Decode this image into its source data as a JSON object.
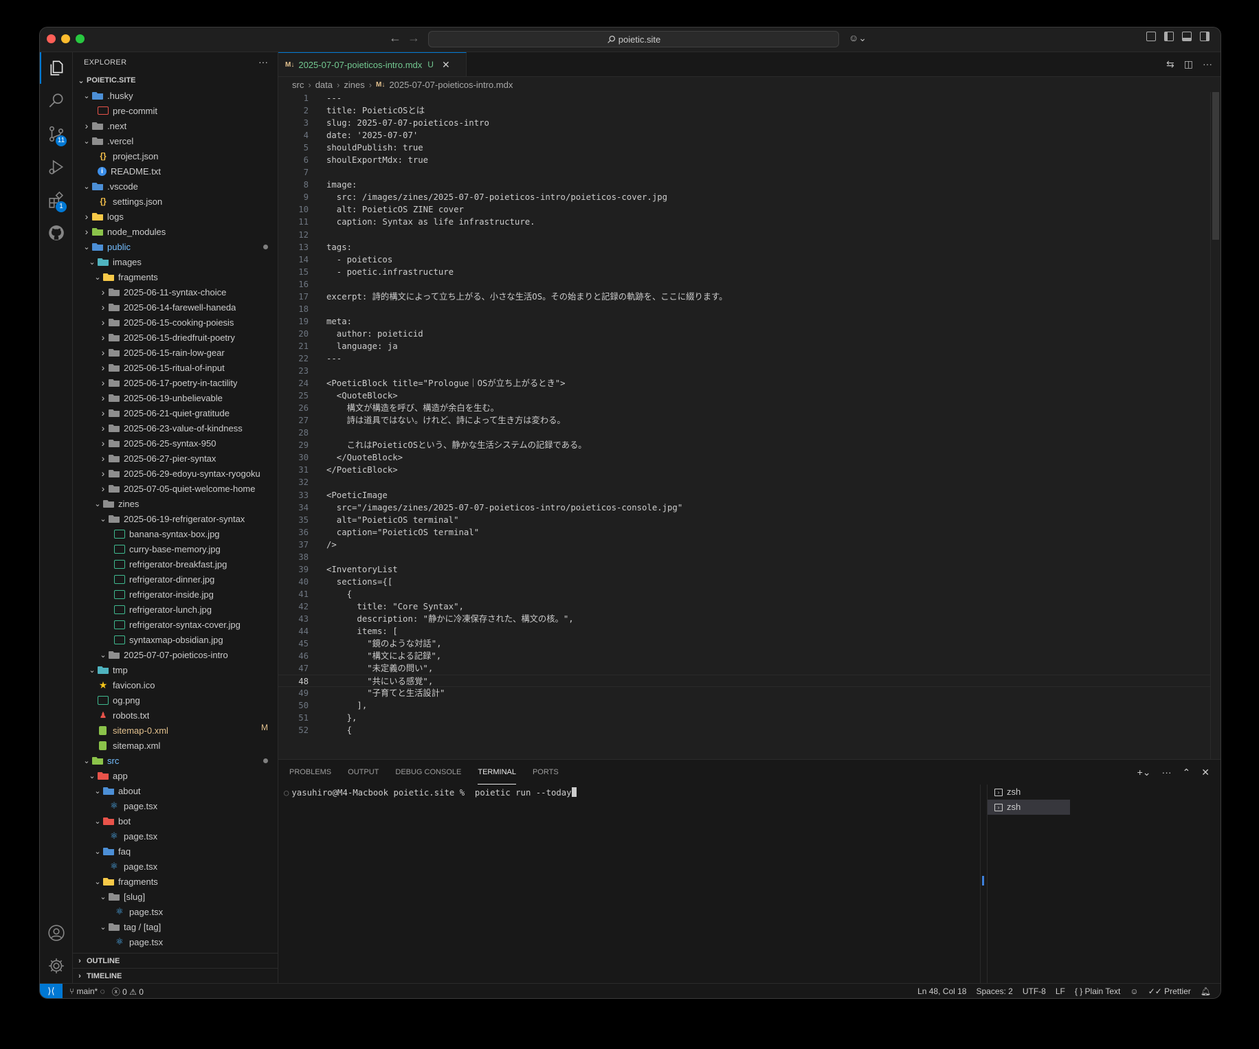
{
  "window": {
    "address": "poietic.site"
  },
  "activity": {
    "scm_badge": "11",
    "extensions_badge": "1"
  },
  "explorer": {
    "title": "EXPLORER",
    "root": "POIETIC.SITE",
    "items": [
      {
        "label": ".husky",
        "depth": 1,
        "kind": "folder",
        "open": true,
        "color": "blue"
      },
      {
        "label": "pre-commit",
        "depth": 2,
        "kind": "term"
      },
      {
        "label": ".next",
        "depth": 1,
        "kind": "folder",
        "open": false,
        "color": "grey"
      },
      {
        "label": ".vercel",
        "depth": 1,
        "kind": "folder",
        "open": true,
        "color": "grey"
      },
      {
        "label": "project.json",
        "depth": 2,
        "kind": "json"
      },
      {
        "label": "README.txt",
        "depth": 2,
        "kind": "info"
      },
      {
        "label": ".vscode",
        "depth": 1,
        "kind": "folder",
        "open": true,
        "color": "blue"
      },
      {
        "label": "settings.json",
        "depth": 2,
        "kind": "json"
      },
      {
        "label": "logs",
        "depth": 1,
        "kind": "folder",
        "open": false,
        "color": "yellow"
      },
      {
        "label": "node_modules",
        "depth": 1,
        "kind": "folder",
        "open": false,
        "color": "green"
      },
      {
        "label": "public",
        "depth": 1,
        "kind": "folder",
        "open": true,
        "color": "blue",
        "dot": true,
        "label_color": "#75beff"
      },
      {
        "label": "images",
        "depth": 2,
        "kind": "folder",
        "open": true,
        "color": "teal"
      },
      {
        "label": "fragments",
        "depth": 3,
        "kind": "folder",
        "open": true,
        "color": "yellow"
      },
      {
        "label": "2025-06-11-syntax-choice",
        "depth": 4,
        "kind": "folder",
        "open": false,
        "color": "grey"
      },
      {
        "label": "2025-06-14-farewell-haneda",
        "depth": 4,
        "kind": "folder",
        "open": false,
        "color": "grey"
      },
      {
        "label": "2025-06-15-cooking-poiesis",
        "depth": 4,
        "kind": "folder",
        "open": false,
        "color": "grey"
      },
      {
        "label": "2025-06-15-driedfruit-poetry",
        "depth": 4,
        "kind": "folder",
        "open": false,
        "color": "grey"
      },
      {
        "label": "2025-06-15-rain-low-gear",
        "depth": 4,
        "kind": "folder",
        "open": false,
        "color": "grey"
      },
      {
        "label": "2025-06-15-ritual-of-input",
        "depth": 4,
        "kind": "folder",
        "open": false,
        "color": "grey"
      },
      {
        "label": "2025-06-17-poetry-in-tactility",
        "depth": 4,
        "kind": "folder",
        "open": false,
        "color": "grey"
      },
      {
        "label": "2025-06-19-unbelievable",
        "depth": 4,
        "kind": "folder",
        "open": false,
        "color": "grey"
      },
      {
        "label": "2025-06-21-quiet-gratitude",
        "depth": 4,
        "kind": "folder",
        "open": false,
        "color": "grey"
      },
      {
        "label": "2025-06-23-value-of-kindness",
        "depth": 4,
        "kind": "folder",
        "open": false,
        "color": "grey"
      },
      {
        "label": "2025-06-25-syntax-950",
        "depth": 4,
        "kind": "folder",
        "open": false,
        "color": "grey"
      },
      {
        "label": "2025-06-27-pier-syntax",
        "depth": 4,
        "kind": "folder",
        "open": false,
        "color": "grey"
      },
      {
        "label": "2025-06-29-edoyu-syntax-ryogoku",
        "depth": 4,
        "kind": "folder",
        "open": false,
        "color": "grey"
      },
      {
        "label": "2025-07-05-quiet-welcome-home",
        "depth": 4,
        "kind": "folder",
        "open": false,
        "color": "grey"
      },
      {
        "label": "zines",
        "depth": 3,
        "kind": "folder",
        "open": true,
        "color": "grey"
      },
      {
        "label": "2025-06-19-refrigerator-syntax",
        "depth": 4,
        "kind": "folder",
        "open": true,
        "color": "grey"
      },
      {
        "label": "banana-syntax-box.jpg",
        "depth": 5,
        "kind": "img"
      },
      {
        "label": "curry-base-memory.jpg",
        "depth": 5,
        "kind": "img"
      },
      {
        "label": "refrigerator-breakfast.jpg",
        "depth": 5,
        "kind": "img"
      },
      {
        "label": "refrigerator-dinner.jpg",
        "depth": 5,
        "kind": "img"
      },
      {
        "label": "refrigerator-inside.jpg",
        "depth": 5,
        "kind": "img"
      },
      {
        "label": "refrigerator-lunch.jpg",
        "depth": 5,
        "kind": "img"
      },
      {
        "label": "refrigerator-syntax-cover.jpg",
        "depth": 5,
        "kind": "img"
      },
      {
        "label": "syntaxmap-obsidian.jpg",
        "depth": 5,
        "kind": "img"
      },
      {
        "label": "2025-07-07-poieticos-intro",
        "depth": 4,
        "kind": "folder",
        "open": true,
        "color": "grey"
      },
      {
        "label": "tmp",
        "depth": 2,
        "kind": "folder",
        "open": true,
        "color": "teal"
      },
      {
        "label": "favicon.ico",
        "depth": 2,
        "kind": "star"
      },
      {
        "label": "og.png",
        "depth": 2,
        "kind": "img"
      },
      {
        "label": "robots.txt",
        "depth": 2,
        "kind": "robot"
      },
      {
        "label": "sitemap-0.xml",
        "depth": 2,
        "kind": "xml",
        "mod": "M",
        "label_color": "#e2c08d"
      },
      {
        "label": "sitemap.xml",
        "depth": 2,
        "kind": "xml"
      },
      {
        "label": "src",
        "depth": 1,
        "kind": "folder",
        "open": true,
        "color": "green",
        "dot": true,
        "label_color": "#75beff"
      },
      {
        "label": "app",
        "depth": 2,
        "kind": "folder",
        "open": true,
        "color": "red"
      },
      {
        "label": "about",
        "depth": 3,
        "kind": "folder",
        "open": true,
        "color": "blue"
      },
      {
        "label": "page.tsx",
        "depth": 4,
        "kind": "react"
      },
      {
        "label": "bot",
        "depth": 3,
        "kind": "folder",
        "open": true,
        "color": "red"
      },
      {
        "label": "page.tsx",
        "depth": 4,
        "kind": "react"
      },
      {
        "label": "faq",
        "depth": 3,
        "kind": "folder",
        "open": true,
        "color": "blue"
      },
      {
        "label": "page.tsx",
        "depth": 4,
        "kind": "react"
      },
      {
        "label": "fragments",
        "depth": 3,
        "kind": "folder",
        "open": true,
        "color": "yellow"
      },
      {
        "label": "[slug]",
        "depth": 4,
        "kind": "folder",
        "open": true,
        "color": "grey"
      },
      {
        "label": "page.tsx",
        "depth": 5,
        "kind": "react"
      },
      {
        "label": "tag / [tag]",
        "depth": 4,
        "kind": "folder",
        "open": true,
        "color": "grey"
      },
      {
        "label": "page.tsx",
        "depth": 5,
        "kind": "react"
      }
    ],
    "outline_label": "OUTLINE",
    "timeline_label": "TIMELINE"
  },
  "editor": {
    "tab": {
      "icon": "M↓",
      "label": "2025-07-07-poieticos-intro.mdx",
      "status": "U"
    },
    "breadcrumb": [
      "src",
      "data",
      "zines",
      "2025-07-07-poieticos-intro.mdx"
    ],
    "current_line": 48,
    "lines": [
      "---",
      "title: PoieticOSとは",
      "slug: 2025-07-07-poieticos-intro",
      "date: '2025-07-07'",
      "shouldPublish: true",
      "shoulExportMdx: true",
      "",
      "image:",
      "  src: /images/zines/2025-07-07-poieticos-intro/poieticos-cover.jpg",
      "  alt: PoieticOS ZINE cover",
      "  caption: Syntax as life infrastructure.",
      "",
      "tags:",
      "  - poieticos",
      "  - poetic.infrastructure",
      "",
      "excerpt: 詩的構文によって立ち上がる、小さな生活OS。その始まりと記録の軌跡を、ここに綴ります。",
      "",
      "meta:",
      "  author: poieticid",
      "  language: ja",
      "---",
      "",
      "<PoeticBlock title=\"Prologue｜OSが立ち上がるとき\">",
      "  <QuoteBlock>",
      "    構文が構造を呼び、構造が余白を生む。",
      "    詩は道具ではない。けれど、詩によって生き方は変わる。",
      "",
      "    これはPoieticOSという、静かな生活システムの記録である。",
      "  </QuoteBlock>",
      "</PoeticBlock>",
      "",
      "<PoeticImage",
      "  src=\"/images/zines/2025-07-07-poieticos-intro/poieticos-console.jpg\"",
      "  alt=\"PoieticOS terminal\"",
      "  caption=\"PoieticOS terminal\"",
      "/>",
      "",
      "<InventoryList",
      "  sections={[",
      "    {",
      "      title: \"Core Syntax\",",
      "      description: \"静かに冷凍保存された、構文の核。\",",
      "      items: [",
      "        \"鏡のような対話\",",
      "        \"構文による記録\",",
      "        \"未定義の問い\",",
      "        \"共にいる感覚\",",
      "        \"子育てと生活設計\"",
      "      ],",
      "    },",
      "    {"
    ]
  },
  "panel": {
    "tabs": [
      "PROBLEMS",
      "OUTPUT",
      "DEBUG CONSOLE",
      "TERMINAL",
      "PORTS"
    ],
    "active_tab": "TERMINAL",
    "prompt": "yasuhiro@M4-Macbook poietic.site %  poietic run --today",
    "terminals": [
      "zsh",
      "zsh"
    ]
  },
  "status": {
    "branch": "main*",
    "errors": "0",
    "warnings": "0",
    "position": "Ln 48, Col 18",
    "spaces": "Spaces: 2",
    "encoding": "UTF-8",
    "eol": "LF",
    "language": "Plain Text",
    "formatter": "Prettier"
  },
  "colors": {
    "accent": "#0078d4",
    "untracked": "#73c991",
    "modified": "#e2c08d"
  }
}
